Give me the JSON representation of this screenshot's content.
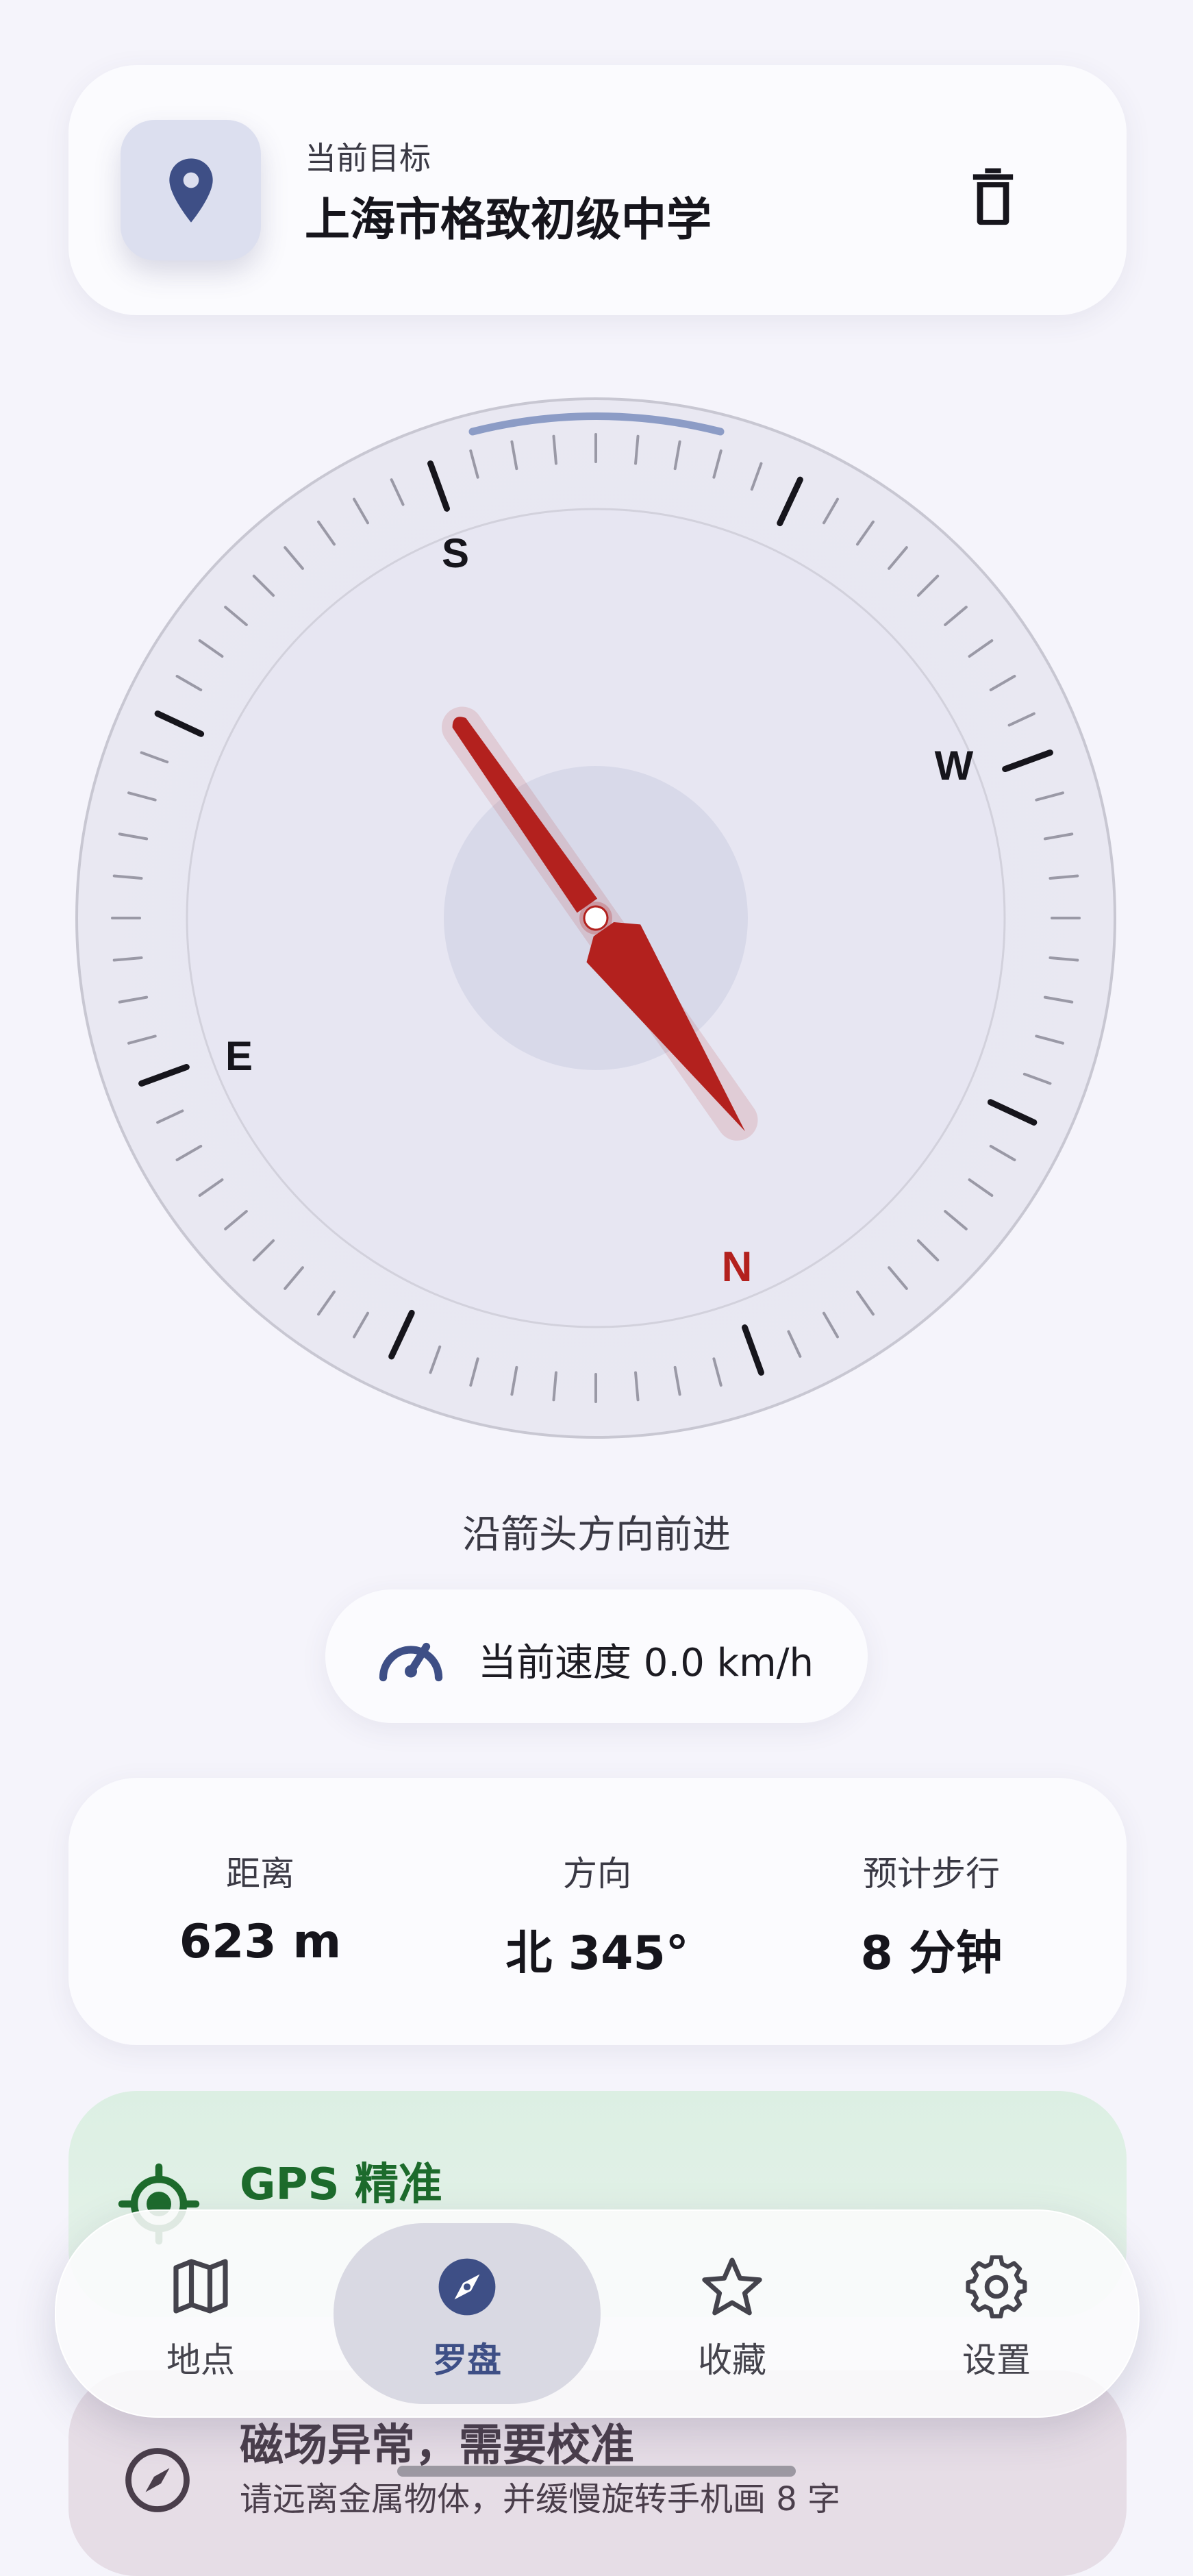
{
  "target": {
    "label": "当前目标",
    "name": "上海市格致初级中学"
  },
  "compass": {
    "labels": {
      "n": "N",
      "e": "E",
      "s": "S",
      "w": "W"
    },
    "heading_deg": 345
  },
  "hint": "沿箭头方向前进",
  "speed": {
    "text": "当前速度 0.0 km/h"
  },
  "stats": [
    {
      "label": "距离",
      "value": "623 m"
    },
    {
      "label": "方向",
      "value": "北 345°"
    },
    {
      "label": "预计步行",
      "value": "8 分钟"
    }
  ],
  "gps": {
    "title": "GPS 精准"
  },
  "magnetic": {
    "title": "磁场异常，需要校准",
    "subtitle": "请远离金属物体，并缓慢旋转手机画 8 字"
  },
  "nav": {
    "items": [
      {
        "label": "地点",
        "icon": "map-icon",
        "active": false
      },
      {
        "label": "罗盘",
        "icon": "compass-icon",
        "active": true
      },
      {
        "label": "收藏",
        "icon": "star-icon",
        "active": false
      },
      {
        "label": "设置",
        "icon": "gear-icon",
        "active": false
      }
    ]
  },
  "colors": {
    "accent": "#3e4f86",
    "needle": "#b3211e",
    "gps_green": "#1d6b2c"
  }
}
